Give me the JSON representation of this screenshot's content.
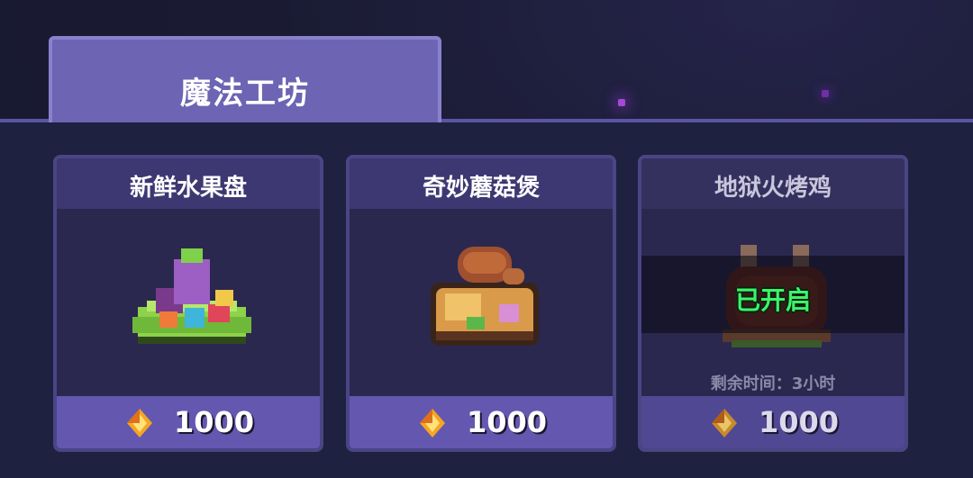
{
  "workshop": {
    "tab_title": "魔法工坊"
  },
  "cards": [
    {
      "title": "新鲜水果盘",
      "price": "1000",
      "icon": "fruit-plate-icon"
    },
    {
      "title": "奇妙蘑菇煲",
      "price": "1000",
      "icon": "mushroom-pot-icon"
    },
    {
      "title": "地狱火烤鸡",
      "price": "1000",
      "icon": "roast-chicken-icon",
      "status": "已开启",
      "remaining": "剩余时间：3小时"
    }
  ],
  "currency_icon": "flame-gem-icon",
  "colors": {
    "tab": "#6d64b3",
    "card_footer": "#6457b0",
    "active_green": "#3ef36a",
    "gem_orange": "#f5a623"
  }
}
